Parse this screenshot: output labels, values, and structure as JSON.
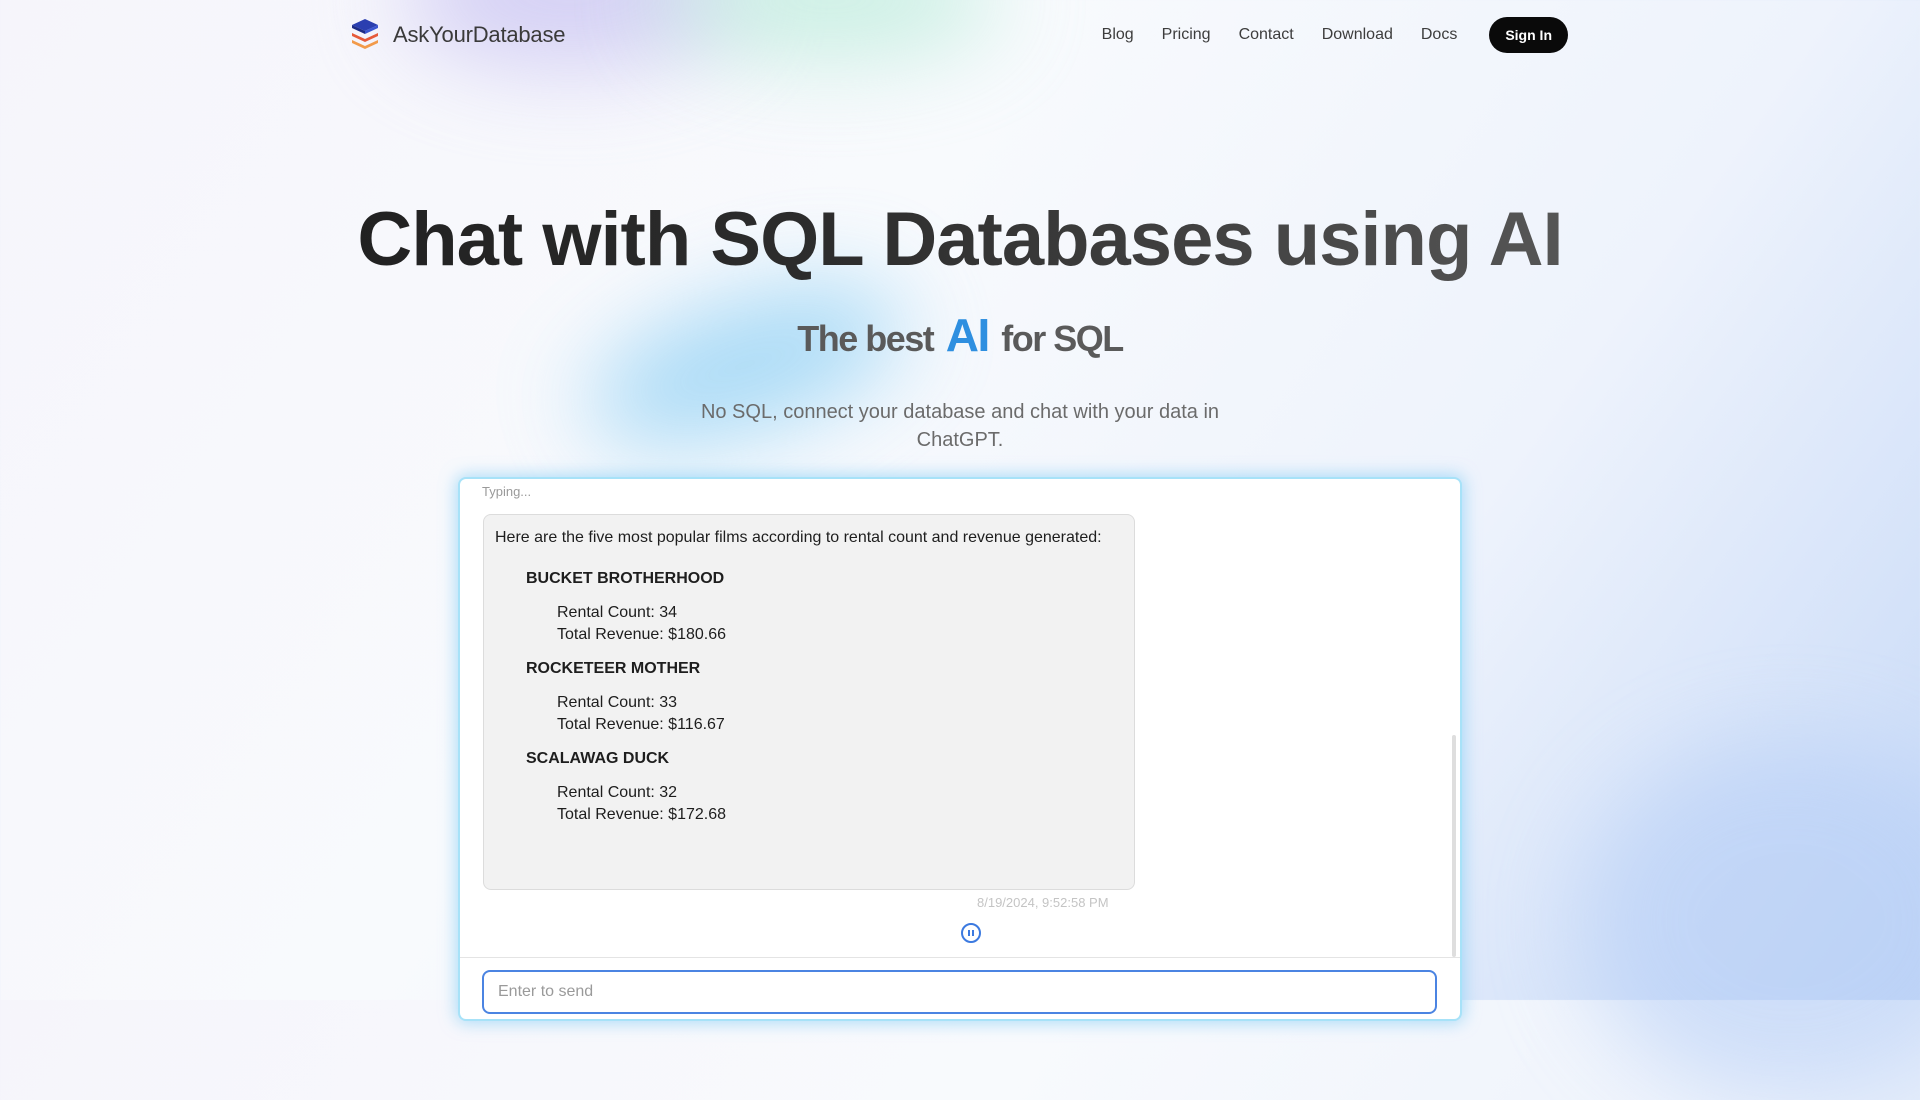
{
  "brand": {
    "name": "AskYourDatabase",
    "logo_icon": "layered-stack-icon"
  },
  "nav": {
    "links": [
      "Blog",
      "Pricing",
      "Contact",
      "Download",
      "Docs"
    ],
    "signin_label": "Sign In"
  },
  "hero": {
    "title": "Chat with SQL Databases using AI",
    "subtitle": {
      "before": "The best",
      "highlight": "AI",
      "after": "for SQL"
    },
    "description": "No SQL, connect your database and chat with your data in ChatGPT."
  },
  "chat": {
    "typing_text": "Typing...",
    "message": {
      "intro": "Here are the five most popular films according to rental count and revenue generated:",
      "films": [
        {
          "name": "BUCKET BROTHERHOOD",
          "rental": "Rental Count: 34",
          "revenue": "Total Revenue: $180.66"
        },
        {
          "name": "ROCKETEER MOTHER",
          "rental": "Rental Count: 33",
          "revenue": "Total Revenue: $116.67"
        },
        {
          "name": "SCALAWAG DUCK",
          "rental": "Rental Count: 32",
          "revenue": "Total Revenue: $172.68"
        }
      ]
    },
    "timestamp": "8/19/2024, 9:52:58 PM",
    "pause_icon": "pause-circle-icon",
    "input_placeholder": "Enter to send"
  },
  "colors": {
    "accent": "#2e8fe0",
    "signin_bg": "#0a0a0a",
    "input_border": "#4b84e2",
    "panel_glow": "#a7e2f8"
  }
}
